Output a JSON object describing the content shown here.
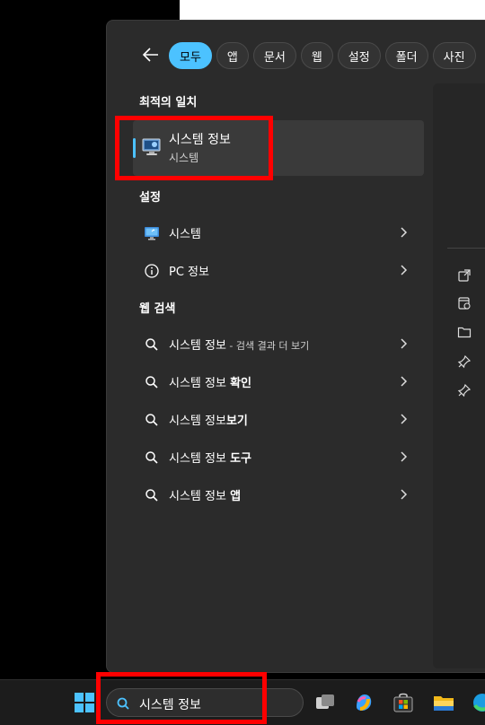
{
  "filters": {
    "chips": [
      "모두",
      "앱",
      "문서",
      "웹",
      "설정",
      "폴더",
      "사진"
    ],
    "active": "모두"
  },
  "best_match": {
    "heading": "최적의 일치",
    "title": "시스템 정보",
    "subtitle": "시스템"
  },
  "settings": {
    "heading": "설정",
    "items": [
      {
        "label": "시스템"
      },
      {
        "label": "PC 정보"
      }
    ]
  },
  "web": {
    "heading": "웹 검색",
    "items": [
      {
        "prefix": "시스템 정보",
        "bold": "",
        "suffix": " - 검색 결과 더 보기"
      },
      {
        "prefix": "시스템 정보 ",
        "bold": "확인",
        "suffix": ""
      },
      {
        "prefix": "시스템 정보",
        "bold": "보기",
        "suffix": ""
      },
      {
        "prefix": "시스템 정보 ",
        "bold": "도구",
        "suffix": ""
      },
      {
        "prefix": "시스템 정보 ",
        "bold": "앱",
        "suffix": ""
      }
    ]
  },
  "taskbar": {
    "search_value": "시스템 정보"
  },
  "colors": {
    "accent": "#4cc2ff",
    "highlight_box": "#ff0000"
  }
}
